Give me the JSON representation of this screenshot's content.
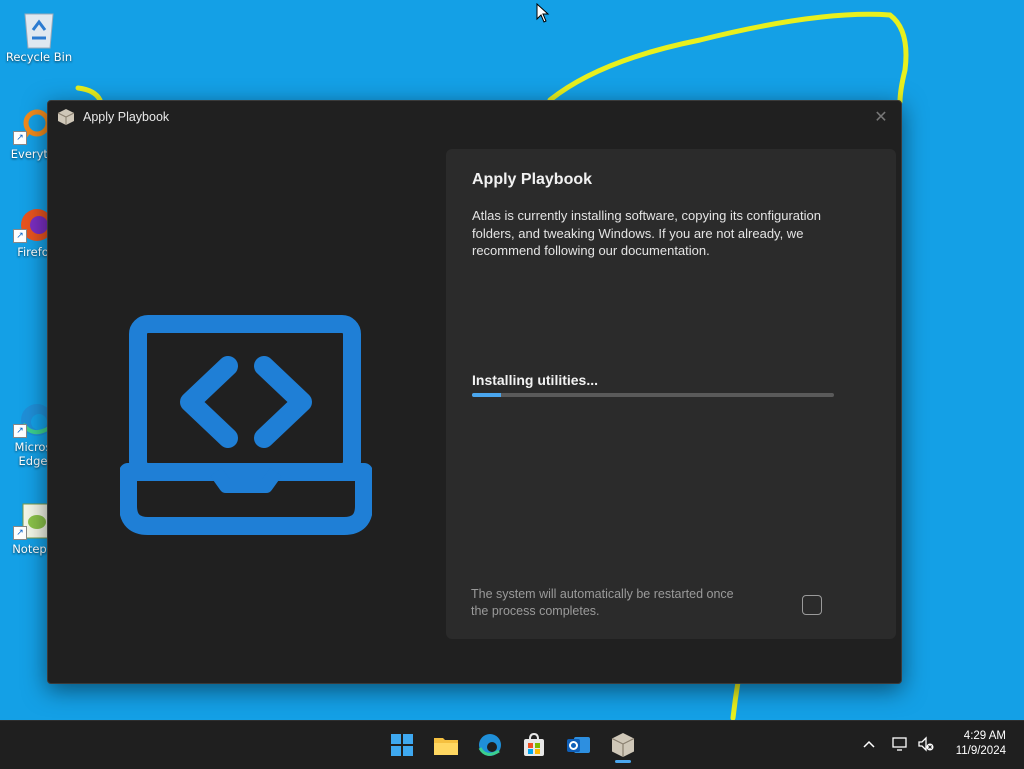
{
  "desktop": {
    "icons": [
      {
        "label": "Recycle Bin"
      },
      {
        "label": "Everyth"
      },
      {
        "label": "Firefo"
      },
      {
        "label": "Micros\nEdge"
      },
      {
        "label": "Notepa"
      }
    ]
  },
  "window": {
    "title": "Apply Playbook",
    "close_glyph": "✕",
    "card": {
      "heading": "Apply Playbook",
      "description": "Atlas is currently installing software, copying its configuration folders, and tweaking Windows. If you are not already, we recommend following our documentation.",
      "status": "Installing utilities...",
      "progress": 0.08,
      "restart_note": "The system will automatically be restarted once the process completes.",
      "restart_checkbox_checked": false
    }
  },
  "taskbar": {
    "icons": [
      "start-icon",
      "file-explorer-icon",
      "edge-icon",
      "store-icon",
      "outlook-icon",
      "playbook-app-icon"
    ],
    "clock": {
      "time": "4:29 AM",
      "date": "11/9/2024"
    }
  },
  "colors": {
    "desktop": "#14a0e6",
    "accent": "#4aa6ee",
    "window_bg": "#202020",
    "card_bg": "#2b2b2b",
    "logo_blue": "#1f7fd6"
  }
}
